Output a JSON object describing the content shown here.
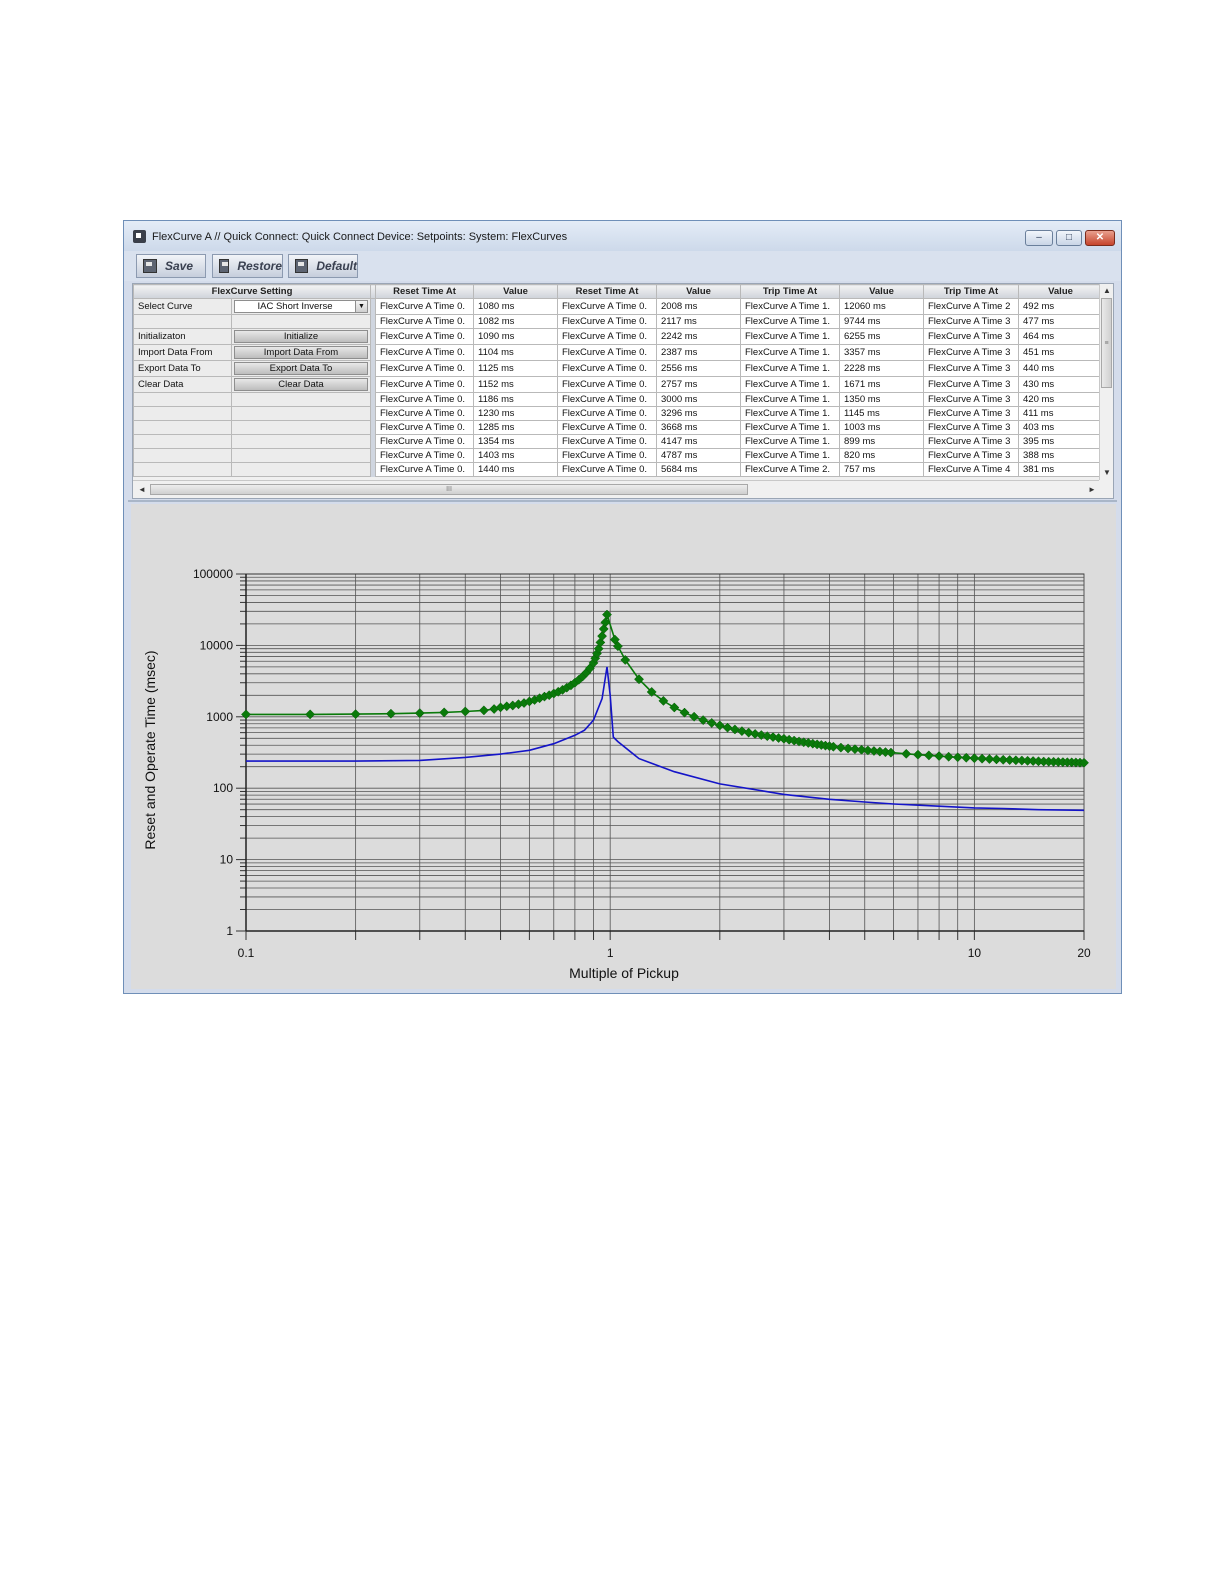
{
  "window": {
    "title": "FlexCurve A // Quick Connect: Quick Connect Device: Setpoints: System: FlexCurves",
    "controls": {
      "minimize": "–",
      "maximize": "□",
      "close": "✕"
    }
  },
  "toolbar": {
    "save_label": "Save",
    "restore_label": "Restore",
    "default_label": "Default",
    "icons": {
      "save": "save-icon",
      "restore": "restore-icon",
      "default": "default-icon"
    }
  },
  "settings": {
    "header": "FlexCurve Setting",
    "select_curve_label": "Select Curve",
    "select_curve_value": "IAC Short Inverse",
    "initialization_label": "Initializaton",
    "initialize_button": "Initialize",
    "import_label": "Import Data From",
    "import_button": "Import Data From",
    "export_label": "Export Data To",
    "export_button": "Export Data To",
    "clear_label": "Clear Data",
    "clear_button": "Clear Data"
  },
  "table": {
    "headers": [
      "Reset Time At",
      "Value",
      "Reset Time At",
      "Value",
      "Trip Time At",
      "Value",
      "Trip Time At",
      "Value"
    ],
    "rows": [
      [
        "FlexCurve A Time 0.",
        "1080 ms",
        "FlexCurve A Time 0.",
        "2008 ms",
        "FlexCurve A Time 1.",
        "12060 ms",
        "FlexCurve A Time 2",
        "492 ms"
      ],
      [
        "FlexCurve A Time 0.",
        "1082 ms",
        "FlexCurve A Time 0.",
        "2117 ms",
        "FlexCurve A Time 1.",
        "9744 ms",
        "FlexCurve A Time 3",
        "477 ms"
      ],
      [
        "FlexCurve A Time 0.",
        "1090 ms",
        "FlexCurve A Time 0.",
        "2242 ms",
        "FlexCurve A Time 1.",
        "6255 ms",
        "FlexCurve A Time 3",
        "464 ms"
      ],
      [
        "FlexCurve A Time 0.",
        "1104 ms",
        "FlexCurve A Time 0.",
        "2387 ms",
        "FlexCurve A Time 1.",
        "3357 ms",
        "FlexCurve A Time 3",
        "451 ms"
      ],
      [
        "FlexCurve A Time 0.",
        "1125 ms",
        "FlexCurve A Time 0.",
        "2556 ms",
        "FlexCurve A Time 1.",
        "2228 ms",
        "FlexCurve A Time 3",
        "440 ms"
      ],
      [
        "FlexCurve A Time 0.",
        "1152 ms",
        "FlexCurve A Time 0.",
        "2757 ms",
        "FlexCurve A Time 1.",
        "1671 ms",
        "FlexCurve A Time 3",
        "430 ms"
      ],
      [
        "FlexCurve A Time 0.",
        "1186 ms",
        "FlexCurve A Time 0.",
        "3000 ms",
        "FlexCurve A Time 1.",
        "1350 ms",
        "FlexCurve A Time 3",
        "420 ms"
      ],
      [
        "FlexCurve A Time 0.",
        "1230 ms",
        "FlexCurve A Time 0.",
        "3296 ms",
        "FlexCurve A Time 1.",
        "1145 ms",
        "FlexCurve A Time 3",
        "411 ms"
      ],
      [
        "FlexCurve A Time 0.",
        "1285 ms",
        "FlexCurve A Time 0.",
        "3668 ms",
        "FlexCurve A Time 1.",
        "1003 ms",
        "FlexCurve A Time 3",
        "403 ms"
      ],
      [
        "FlexCurve A Time 0.",
        "1354 ms",
        "FlexCurve A Time 0.",
        "4147 ms",
        "FlexCurve A Time 1.",
        "899 ms",
        "FlexCurve A Time 3",
        "395 ms"
      ],
      [
        "FlexCurve A Time 0.",
        "1403 ms",
        "FlexCurve A Time 0.",
        "4787 ms",
        "FlexCurve A Time 1.",
        "820 ms",
        "FlexCurve A Time 3",
        "388 ms"
      ],
      [
        "FlexCurve A Time 0.",
        "1440 ms",
        "FlexCurve A Time 0.",
        "5684 ms",
        "FlexCurve A Time 2.",
        "757 ms",
        "FlexCurve A Time 4",
        "381 ms"
      ]
    ]
  },
  "scroll": {
    "grip": "≡",
    "h_grip": "III",
    "up": "▲",
    "down": "▼",
    "left": "◄",
    "right": "►"
  },
  "chart_data": {
    "type": "line",
    "title": "",
    "xlabel": "Multiple of Pickup",
    "ylabel": "Reset and Operate Time (msec)",
    "x_scale": "log",
    "y_scale": "log",
    "xlim": [
      0.1,
      20
    ],
    "ylim": [
      1,
      100000
    ],
    "x_ticks": [
      "0.1",
      "1",
      "10",
      "20"
    ],
    "y_ticks": [
      "1",
      "10",
      "100",
      "1000",
      "10000",
      "100000"
    ],
    "grid": true,
    "series": [
      {
        "color": "#0a7a0a",
        "marker": "diamond",
        "points": [
          [
            0.1,
            1080
          ],
          [
            0.15,
            1082
          ],
          [
            0.2,
            1090
          ],
          [
            0.25,
            1104
          ],
          [
            0.3,
            1125
          ],
          [
            0.35,
            1152
          ],
          [
            0.4,
            1186
          ],
          [
            0.45,
            1230
          ],
          [
            0.48,
            1285
          ],
          [
            0.5,
            1354
          ],
          [
            0.52,
            1403
          ],
          [
            0.54,
            1440
          ],
          [
            0.56,
            1500
          ],
          [
            0.58,
            1560
          ],
          [
            0.6,
            1640
          ],
          [
            0.62,
            1720
          ],
          [
            0.64,
            1820
          ],
          [
            0.66,
            1920
          ],
          [
            0.68,
            2008
          ],
          [
            0.7,
            2117
          ],
          [
            0.72,
            2242
          ],
          [
            0.74,
            2387
          ],
          [
            0.76,
            2556
          ],
          [
            0.78,
            2757
          ],
          [
            0.8,
            3000
          ],
          [
            0.82,
            3296
          ],
          [
            0.84,
            3668
          ],
          [
            0.86,
            4147
          ],
          [
            0.88,
            4787
          ],
          [
            0.9,
            5684
          ],
          [
            0.91,
            6600
          ],
          [
            0.92,
            7700
          ],
          [
            0.93,
            9000
          ],
          [
            0.94,
            11000
          ],
          [
            0.95,
            13500
          ],
          [
            0.96,
            17000
          ],
          [
            0.97,
            21000
          ],
          [
            0.98,
            27000
          ],
          [
            1.03,
            12060
          ],
          [
            1.05,
            9744
          ],
          [
            1.1,
            6255
          ],
          [
            1.2,
            3357
          ],
          [
            1.3,
            2228
          ],
          [
            1.4,
            1671
          ],
          [
            1.5,
            1350
          ],
          [
            1.6,
            1145
          ],
          [
            1.7,
            1003
          ],
          [
            1.8,
            899
          ],
          [
            1.9,
            820
          ],
          [
            2.0,
            757
          ],
          [
            2.1,
            705
          ],
          [
            2.2,
            665
          ],
          [
            2.3,
            630
          ],
          [
            2.4,
            600
          ],
          [
            2.5,
            575
          ],
          [
            2.6,
            555
          ],
          [
            2.7,
            535
          ],
          [
            2.8,
            520
          ],
          [
            2.9,
            505
          ],
          [
            3.0,
            492
          ],
          [
            3.1,
            477
          ],
          [
            3.2,
            464
          ],
          [
            3.3,
            451
          ],
          [
            3.4,
            440
          ],
          [
            3.5,
            430
          ],
          [
            3.6,
            420
          ],
          [
            3.7,
            411
          ],
          [
            3.8,
            403
          ],
          [
            3.9,
            395
          ],
          [
            4.0,
            388
          ],
          [
            4.1,
            381
          ],
          [
            4.3,
            370
          ],
          [
            4.5,
            360
          ],
          [
            4.7,
            352
          ],
          [
            4.9,
            345
          ],
          [
            5.1,
            338
          ],
          [
            5.3,
            332
          ],
          [
            5.5,
            326
          ],
          [
            5.7,
            320
          ],
          [
            5.9,
            315
          ],
          [
            6.5,
            303
          ],
          [
            7.0,
            295
          ],
          [
            7.5,
            288
          ],
          [
            8.0,
            282
          ],
          [
            8.5,
            276
          ],
          [
            9.0,
            271
          ],
          [
            9.5,
            267
          ],
          [
            10.0,
            263
          ],
          [
            10.5,
            259
          ],
          [
            11.0,
            256
          ],
          [
            11.5,
            253
          ],
          [
            12.0,
            250
          ],
          [
            12.5,
            248
          ],
          [
            13.0,
            246
          ],
          [
            13.5,
            244
          ],
          [
            14.0,
            242
          ],
          [
            14.5,
            240
          ],
          [
            15.0,
            238
          ],
          [
            15.5,
            236
          ],
          [
            16.0,
            235
          ],
          [
            16.5,
            234
          ],
          [
            17.0,
            233
          ],
          [
            17.5,
            232
          ],
          [
            18.0,
            231
          ],
          [
            18.5,
            230
          ],
          [
            19.0,
            229
          ],
          [
            19.5,
            228
          ],
          [
            20.0,
            227
          ]
        ]
      },
      {
        "color": "#1414c8",
        "marker": "none",
        "points": [
          [
            0.1,
            240
          ],
          [
            0.2,
            240
          ],
          [
            0.3,
            245
          ],
          [
            0.4,
            270
          ],
          [
            0.5,
            300
          ],
          [
            0.6,
            340
          ],
          [
            0.7,
            420
          ],
          [
            0.8,
            550
          ],
          [
            0.85,
            650
          ],
          [
            0.9,
            900
          ],
          [
            0.95,
            1800
          ],
          [
            0.98,
            5000
          ],
          [
            1.0,
            2000
          ],
          [
            1.02,
            520
          ],
          [
            1.05,
            450
          ],
          [
            1.2,
            260
          ],
          [
            1.5,
            170
          ],
          [
            2.0,
            115
          ],
          [
            3.0,
            82
          ],
          [
            4.0,
            70
          ],
          [
            5.0,
            64
          ],
          [
            6.0,
            60
          ],
          [
            8.0,
            56
          ],
          [
            10.0,
            53
          ],
          [
            12.0,
            52
          ],
          [
            15.0,
            50
          ],
          [
            20.0,
            49
          ]
        ]
      }
    ]
  }
}
